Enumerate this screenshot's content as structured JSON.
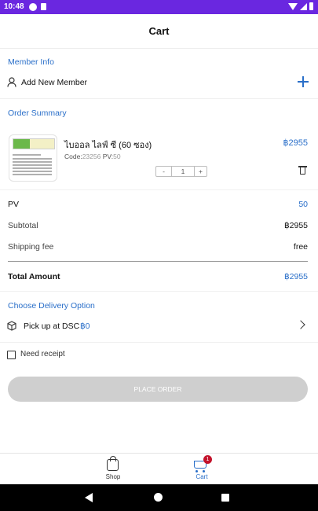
{
  "status_bar": {
    "time": "10:48"
  },
  "app_bar": {
    "title": "Cart"
  },
  "member_info": {
    "section_title": "Member Info",
    "add_label": "Add New Member"
  },
  "order_summary": {
    "section_title": "Order Summary",
    "item": {
      "name": "ไบออล ไลฟ์ ซี (60 ซอง)",
      "code_label": "Code:",
      "code_value": "23256",
      "pv_label": "PV:",
      "pv_value": "50",
      "price": "฿2955",
      "quantity": "1",
      "minus": "-",
      "plus": "+"
    }
  },
  "summary": {
    "pv_label": "PV",
    "pv_value": "50",
    "subtotal_label": "Subtotal",
    "subtotal_value": "฿2955",
    "shipping_label": "Shipping fee",
    "shipping_value": "free",
    "total_label": "Total Amount",
    "total_value": "฿2955"
  },
  "delivery": {
    "section_title": "Choose Delivery Option",
    "option_label": "Pick up at DSC",
    "option_price": "฿0"
  },
  "receipt": {
    "label": "Need receipt",
    "checked": false
  },
  "place_order": {
    "label": "PLACE ORDER",
    "enabled": false
  },
  "bottom_nav": {
    "shop_label": "Shop",
    "cart_label": "Cart",
    "cart_badge": "1",
    "active": "cart"
  },
  "colors": {
    "accent": "#2a6fc9",
    "status_bar": "#6a27e0",
    "badge": "#c3122b",
    "disabled_button": "#cfcfcf"
  },
  "icons": [
    "person-icon",
    "plus-icon",
    "trash-icon",
    "box-icon",
    "chevron-right-icon",
    "shopping-bag-icon",
    "cart-icon"
  ]
}
